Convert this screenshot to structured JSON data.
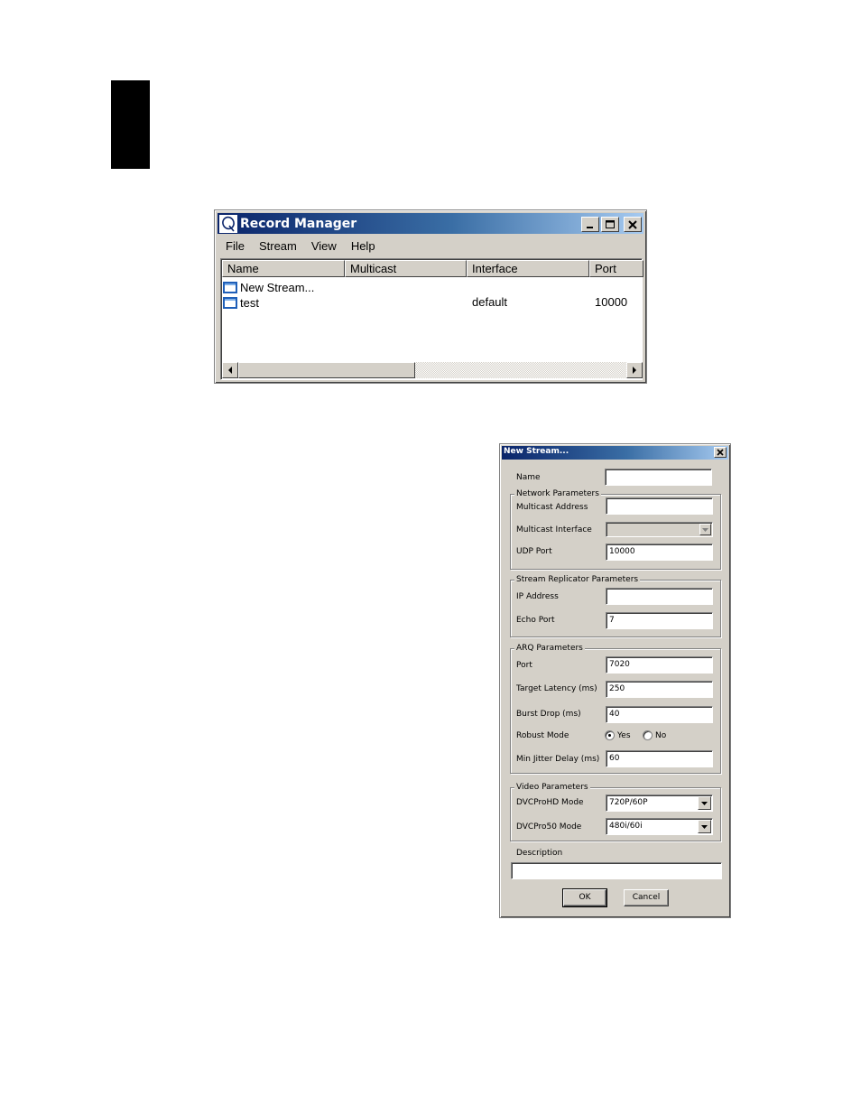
{
  "record_manager": {
    "title": "Record Manager",
    "menu": [
      "File",
      "Stream",
      "View",
      "Help"
    ],
    "columns": [
      "Name",
      "Multicast",
      "Interface",
      "Port"
    ],
    "rows": [
      {
        "name": "New Stream...",
        "multicast": "",
        "interface": "",
        "port": ""
      },
      {
        "name": "test",
        "multicast": "",
        "interface": "default",
        "port": "10000"
      }
    ]
  },
  "new_stream": {
    "title": "New Stream...",
    "name_label": "Name",
    "name_value": "",
    "network": {
      "title": "Network Parameters",
      "multicast_address_label": "Multicast Address",
      "multicast_address_value": "",
      "multicast_interface_label": "Multicast Interface",
      "multicast_interface_value": "",
      "udp_port_label": "UDP Port",
      "udp_port_value": "10000"
    },
    "replicator": {
      "title": "Stream Replicator Parameters",
      "ip_address_label": "IP Address",
      "ip_address_value": "",
      "echo_port_label": "Echo Port",
      "echo_port_value": "7"
    },
    "arq": {
      "title": "ARQ Parameters",
      "port_label": "Port",
      "port_value": "7020",
      "target_latency_label": "Target Latency (ms)",
      "target_latency_value": "250",
      "burst_drop_label": "Burst Drop (ms)",
      "burst_drop_value": "40",
      "robust_mode_label": "Robust Mode",
      "robust_yes": "Yes",
      "robust_no": "No",
      "robust_selected": "Yes",
      "min_jitter_label": "Min Jitter Delay (ms)",
      "min_jitter_value": "60"
    },
    "video": {
      "title": "Video Parameters",
      "dvcprohd_label": "DVCProHD Mode",
      "dvcprohd_value": "720P/60P",
      "dvcpro50_label": "DVCPro50 Mode",
      "dvcpro50_value": "480i/60i"
    },
    "description_label": "Description",
    "description_value": "",
    "ok_label": "OK",
    "cancel_label": "Cancel"
  }
}
